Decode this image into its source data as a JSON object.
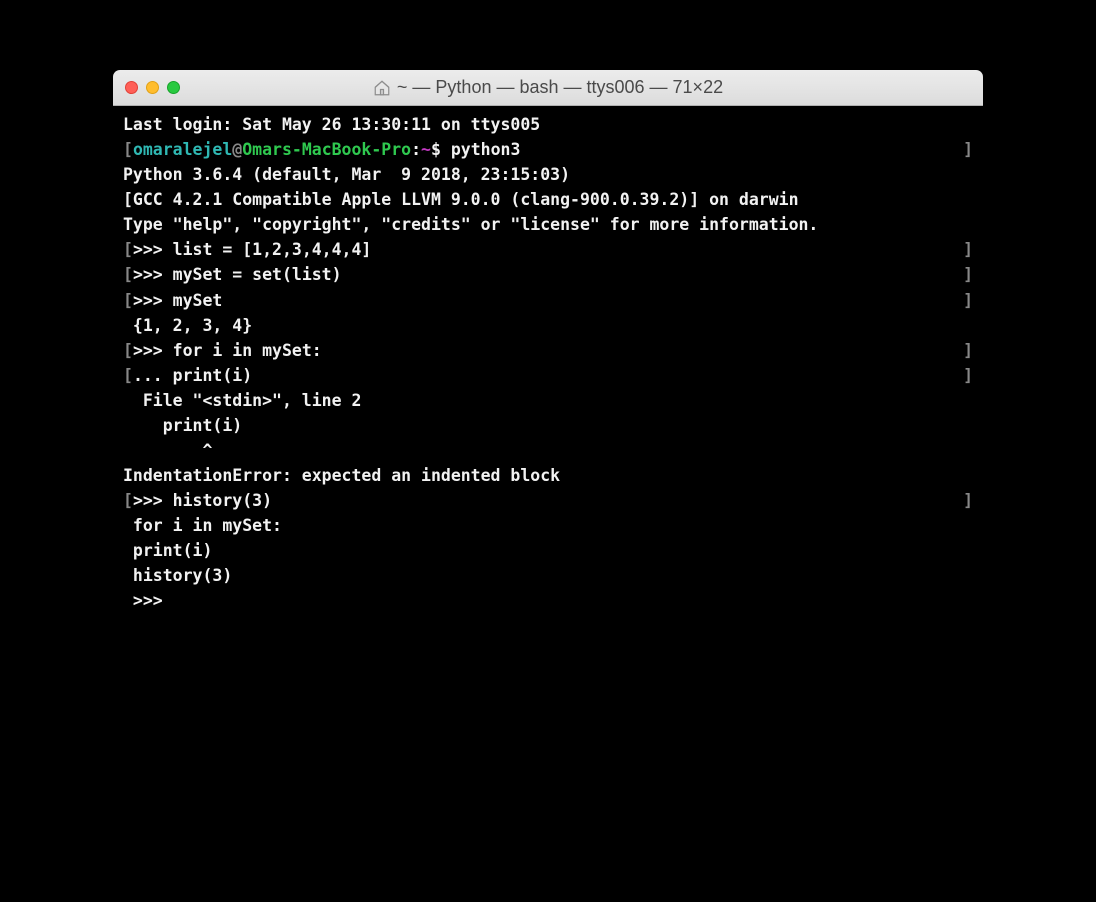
{
  "window": {
    "title": "~ — Python — bash — ttys006 — 71×22"
  },
  "prompt": {
    "user": "omaralejel",
    "at": "@",
    "host": "Omars-MacBook-Pro",
    "colon": ":",
    "path": "~",
    "dollar": "$",
    "command": " python3"
  },
  "lines": {
    "last_login": "Last login: Sat May 26 13:30:11 on ttys005",
    "py_version": "Python 3.6.4 (default, Mar  9 2018, 23:15:03) ",
    "py_gcc": "[GCC 4.2.1 Compatible Apple LLVM 9.0.0 (clang-900.0.39.2)] on darwin",
    "py_help": "Type \"help\", \"copyright\", \"credits\" or \"license\" for more information.",
    "repl1": ">>> list = [1,2,3,4,4,4]",
    "repl2": ">>> mySet = set(list)",
    "repl3": ">>> mySet",
    "out_set": " {1, 2, 3, 4}",
    "repl4": ">>> for i in mySet:",
    "repl5": "... print(i)",
    "err_file": "  File \"<stdin>\", line 2",
    "err_code": "    print(i)",
    "err_caret": "        ^",
    "err_msg": "IndentationError: expected an indented block",
    "repl6": ">>> history(3)",
    "hist1": " for i in mySet:",
    "hist2": " print(i)",
    "hist3": " history(3)",
    "repl7": " >>> "
  }
}
